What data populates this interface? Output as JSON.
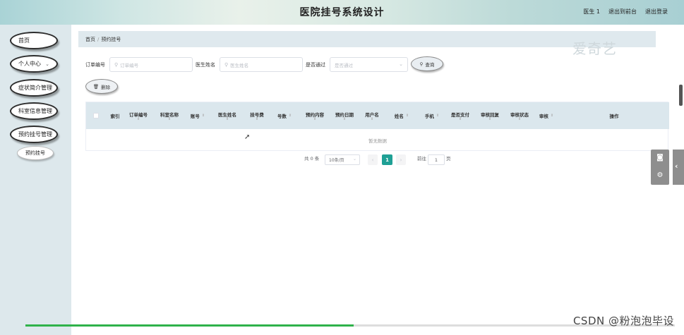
{
  "header": {
    "title": "医院挂号系统设计",
    "user": "医生 1",
    "links": [
      "退出到前台",
      "退出登录"
    ]
  },
  "sidebar": {
    "items": [
      {
        "label": "首页"
      },
      {
        "label": "个人中心"
      },
      {
        "label": "症状简介管理"
      },
      {
        "label": "科室信息管理"
      },
      {
        "label": "预约挂号管理"
      }
    ],
    "sub_item": "预约挂号"
  },
  "breadcrumb": {
    "home": "首页",
    "separator": "/",
    "current": "预约挂号"
  },
  "watermark": "爱奇艺",
  "search": {
    "order_label": "订单编号",
    "order_placeholder": "订单编号",
    "doctor_label": "医生姓名",
    "doctor_placeholder": "医生姓名",
    "approved_label": "是否通过",
    "approved_placeholder": "是否通过",
    "query_button": "查询"
  },
  "delete_button": "删除",
  "table": {
    "columns": [
      "索引",
      "订单编号",
      "科室名称",
      "账号",
      "医生姓名",
      "挂号费",
      "号数",
      "预约内容",
      "预约日期",
      "用户名",
      "姓名",
      "手机",
      "是否支付",
      "审核回复",
      "审核状态",
      "审核",
      "操作"
    ],
    "empty_text": "暂无数据"
  },
  "pagination": {
    "total": "共 0 条",
    "page_size": "10条/页",
    "current_page": "1",
    "goto_label": "前往",
    "goto_value": "1",
    "page_unit": "页"
  },
  "footer_watermark": "CSDN @粉泡泡毕设",
  "colors": {
    "accent": "#1fa095",
    "progress": "#2fb24a",
    "table_header": "#dbe7ed"
  }
}
